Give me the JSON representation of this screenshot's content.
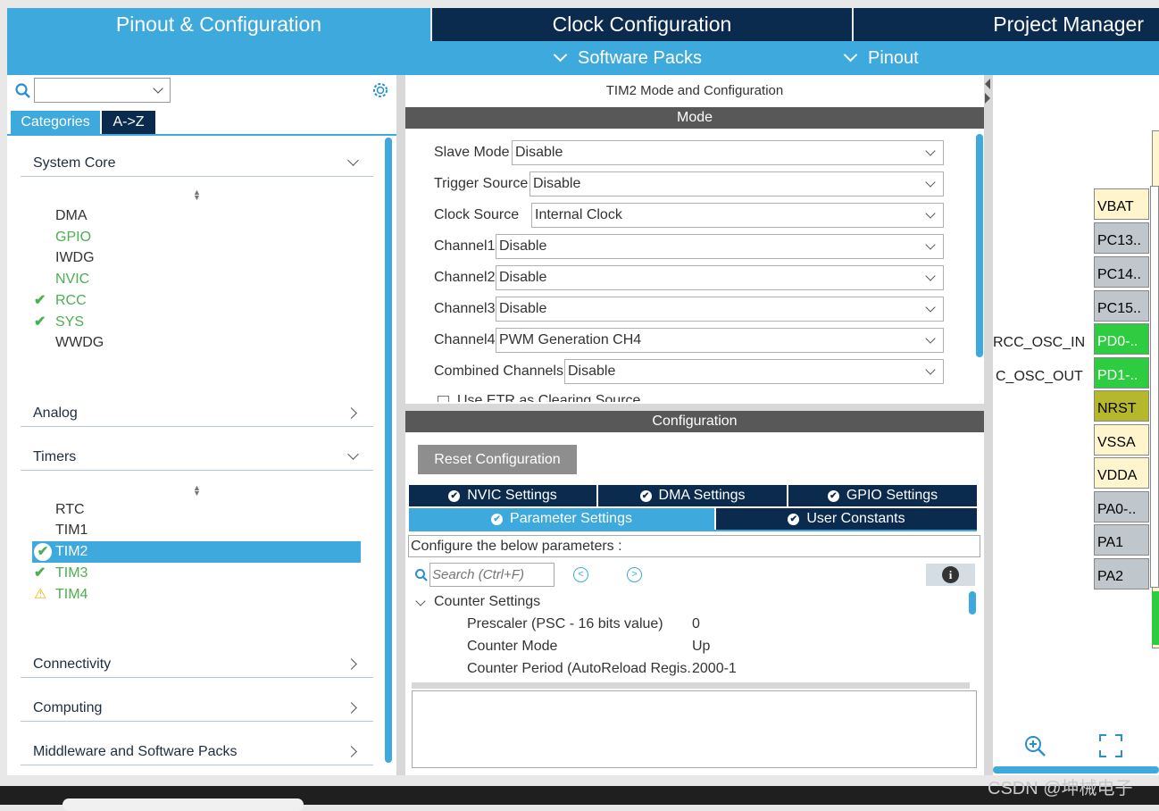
{
  "top_tabs": {
    "pinout": "Pinout & Configuration",
    "clock": "Clock Configuration",
    "project": "Project Manager"
  },
  "sub_menu": {
    "software_packs": "Software Packs",
    "pinout": "Pinout"
  },
  "left": {
    "tab_categories": "Categories",
    "tab_az": "A->Z",
    "system_core": {
      "label": "System Core",
      "items": [
        "DMA",
        "GPIO",
        "IWDG",
        "NVIC",
        "RCC",
        "SYS",
        "WWDG"
      ]
    },
    "analog": "Analog",
    "timers": {
      "label": "Timers",
      "items": [
        "RTC",
        "TIM1",
        "TIM2",
        "TIM3",
        "TIM4"
      ]
    },
    "connectivity": "Connectivity",
    "computing": "Computing",
    "middleware": "Middleware and Software Packs"
  },
  "center": {
    "title": "TIM2 Mode and Configuration",
    "mode_header": "Mode",
    "fields": [
      {
        "label": "Slave Mode",
        "value": "Disable"
      },
      {
        "label": "Trigger Source",
        "value": "Disable"
      },
      {
        "label": "Clock Source",
        "value": "Internal Clock"
      },
      {
        "label": "Channel1",
        "value": "Disable"
      },
      {
        "label": "Channel2",
        "value": "Disable"
      },
      {
        "label": "Channel3",
        "value": "Disable"
      },
      {
        "label": "Channel4",
        "value": "PWM Generation CH4"
      },
      {
        "label": "Combined Channels",
        "value": "Disable"
      }
    ],
    "etr_label": "Use ETR as Clearing Source",
    "config_header": "Configuration",
    "reset_button": "Reset Configuration",
    "tabs": {
      "nvic": "NVIC Settings",
      "dma": "DMA Settings",
      "gpio": "GPIO Settings",
      "params": "Parameter Settings",
      "user_constants": "User Constants"
    },
    "configure_text": "Configure the below parameters :",
    "search_placeholder": "Search (Ctrl+F)",
    "counter_settings": "Counter Settings",
    "params": [
      {
        "name": "Prescaler (PSC - 16 bits value)",
        "value": "0"
      },
      {
        "name": "Counter Mode",
        "value": "Up"
      },
      {
        "name": "Counter Period (AutoReload Regis..",
        "value": "2000-1"
      }
    ]
  },
  "right": {
    "rcc_osc_in": "RCC_OSC_IN",
    "rcc_osc_out": "C_OSC_OUT",
    "pins": [
      {
        "label": "VBAT",
        "color": "#fff5cc"
      },
      {
        "label": "PC13..",
        "color": "#bfc7cc"
      },
      {
        "label": "PC14..",
        "color": "#bfc7cc"
      },
      {
        "label": "PC15..",
        "color": "#bfc7cc"
      },
      {
        "label": "PD0-..",
        "color": "#2ecc40"
      },
      {
        "label": "PD1-..",
        "color": "#2ecc40"
      },
      {
        "label": "NRST",
        "color": "#b5b82a"
      },
      {
        "label": "VSSA",
        "color": "#fff5cc"
      },
      {
        "label": "VDDA",
        "color": "#fff5cc"
      },
      {
        "label": "PA0-..",
        "color": "#bfc7cc"
      },
      {
        "label": "PA1",
        "color": "#bfc7cc"
      },
      {
        "label": "PA2",
        "color": "#bfc7cc"
      }
    ]
  },
  "watermark": "CSDN @坤械电子",
  "colors": {
    "accent": "#3ea9dc",
    "dark_tab": "#0a2b4e",
    "green": "#4caf50",
    "section_bar": "#585858"
  }
}
